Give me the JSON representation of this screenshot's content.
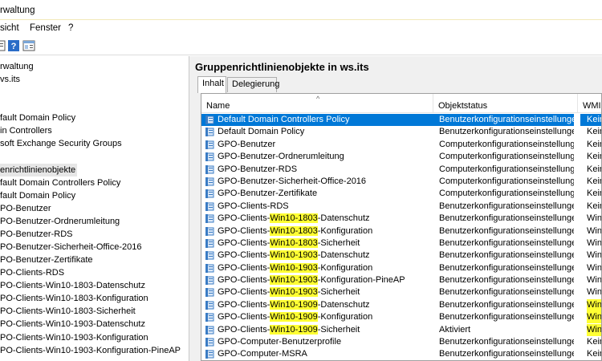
{
  "window": {
    "title": "rwaltung"
  },
  "menu": {
    "items": [
      "sicht",
      "Fenster",
      "?"
    ]
  },
  "tree": {
    "nodes": [
      {
        "label": "rwaltung",
        "selected": false
      },
      {
        "label": "vs.its",
        "selected": false
      },
      {
        "label": "",
        "selected": false
      },
      {
        "label": "fault Domain Policy",
        "selected": false
      },
      {
        "label": "in Controllers",
        "selected": false
      },
      {
        "label": "soft Exchange Security Groups",
        "selected": false
      },
      {
        "label": "",
        "selected": false
      },
      {
        "label": "enrichtlinienobjekte",
        "selected": true
      },
      {
        "label": "fault Domain Controllers Policy",
        "selected": false
      },
      {
        "label": "fault Domain Policy",
        "selected": false
      },
      {
        "label": "PO-Benutzer",
        "selected": false
      },
      {
        "label": "PO-Benutzer-Ordnerumleitung",
        "selected": false
      },
      {
        "label": "PO-Benutzer-RDS",
        "selected": false
      },
      {
        "label": "PO-Benutzer-Sicherheit-Office-2016",
        "selected": false
      },
      {
        "label": "PO-Benutzer-Zertifikate",
        "selected": false
      },
      {
        "label": "PO-Clients-RDS",
        "selected": false
      },
      {
        "label": "PO-Clients-Win10-1803-Datenschutz",
        "selected": false
      },
      {
        "label": "PO-Clients-Win10-1803-Konfiguration",
        "selected": false
      },
      {
        "label": "PO-Clients-Win10-1803-Sicherheit",
        "selected": false
      },
      {
        "label": "PO-Clients-Win10-1903-Datenschutz",
        "selected": false
      },
      {
        "label": "PO-Clients-Win10-1903-Konfiguration",
        "selected": false
      },
      {
        "label": "PO-Clients-Win10-1903-Konfiguration-PineAP",
        "selected": false
      }
    ]
  },
  "panel": {
    "heading": "Gruppenrichtlinienobjekte in ws.its",
    "tabs": [
      "Inhalt",
      "Delegierung"
    ],
    "columns": [
      "Name",
      "Objektstatus",
      "WMI"
    ],
    "rows": [
      {
        "pre": "Default Domain Controllers Policy",
        "hl": "",
        "post": "",
        "status": "Benutzerkonfigurationseinstellungen d...",
        "wmi": "Keine",
        "wmi_hl": false,
        "selected": true
      },
      {
        "pre": "Default Domain Policy",
        "hl": "",
        "post": "",
        "status": "Benutzerkonfigurationseinstellungen d...",
        "wmi": "Keine",
        "wmi_hl": false,
        "selected": false
      },
      {
        "pre": "GPO-Benutzer",
        "hl": "",
        "post": "",
        "status": "Computerkonfigurationseinstellungen d...",
        "wmi": "Keine",
        "wmi_hl": false,
        "selected": false
      },
      {
        "pre": "GPO-Benutzer-Ordnerumleitung",
        "hl": "",
        "post": "",
        "status": "Computerkonfigurationseinstellungen d...",
        "wmi": "Keine",
        "wmi_hl": false,
        "selected": false
      },
      {
        "pre": "GPO-Benutzer-RDS",
        "hl": "",
        "post": "",
        "status": "Computerkonfigurationseinstellungen d...",
        "wmi": "Keine",
        "wmi_hl": false,
        "selected": false
      },
      {
        "pre": "GPO-Benutzer-Sicherheit-Office-2016",
        "hl": "",
        "post": "",
        "status": "Computerkonfigurationseinstellungen d...",
        "wmi": "Keine",
        "wmi_hl": false,
        "selected": false
      },
      {
        "pre": "GPO-Benutzer-Zertifikate",
        "hl": "",
        "post": "",
        "status": "Computerkonfigurationseinstellungen d...",
        "wmi": "Keine",
        "wmi_hl": false,
        "selected": false
      },
      {
        "pre": "GPO-Clients-RDS",
        "hl": "",
        "post": "",
        "status": "Benutzerkonfigurationseinstellungen d...",
        "wmi": "Keine",
        "wmi_hl": false,
        "selected": false
      },
      {
        "pre": "GPO-Clients-",
        "hl": "Win10-1803",
        "post": "-Datenschutz",
        "status": "Benutzerkonfigurationseinstellungen d...",
        "wmi": "Wind",
        "wmi_hl": false,
        "selected": false
      },
      {
        "pre": "GPO-Clients-",
        "hl": "Win10-1803",
        "post": "-Konfiguration",
        "status": "Benutzerkonfigurationseinstellungen d...",
        "wmi": "Wind",
        "wmi_hl": false,
        "selected": false
      },
      {
        "pre": "GPO-Clients-",
        "hl": "Win10-1803",
        "post": "-Sicherheit",
        "status": "Benutzerkonfigurationseinstellungen d...",
        "wmi": "Wind",
        "wmi_hl": false,
        "selected": false
      },
      {
        "pre": "GPO-Clients-",
        "hl": "Win10-1903",
        "post": "-Datenschutz",
        "status": "Benutzerkonfigurationseinstellungen d...",
        "wmi": "Wind",
        "wmi_hl": false,
        "selected": false
      },
      {
        "pre": "GPO-Clients-",
        "hl": "Win10-1903",
        "post": "-Konfiguration",
        "status": "Benutzerkonfigurationseinstellungen d...",
        "wmi": "Wind",
        "wmi_hl": false,
        "selected": false
      },
      {
        "pre": "GPO-Clients-",
        "hl": "Win10-1903",
        "post": "-Konfiguration-PineAP",
        "status": "Benutzerkonfigurationseinstellungen d...",
        "wmi": "Wind",
        "wmi_hl": false,
        "selected": false
      },
      {
        "pre": "GPO-Clients-",
        "hl": "Win10-1903",
        "post": "-Sicherheit",
        "status": "Benutzerkonfigurationseinstellungen d...",
        "wmi": "Wind",
        "wmi_hl": false,
        "selected": false
      },
      {
        "pre": "GPO-Clients-",
        "hl": "Win10-1909",
        "post": "-Datenschutz",
        "status": "Benutzerkonfigurationseinstellungen d...",
        "wmi": "Wind",
        "wmi_hl": true,
        "selected": false
      },
      {
        "pre": "GPO-Clients-",
        "hl": "Win10-1909",
        "post": "-Konfiguration",
        "status": "Benutzerkonfigurationseinstellungen d...",
        "wmi": "Wind",
        "wmi_hl": true,
        "selected": false
      },
      {
        "pre": "GPO-Clients-",
        "hl": "Win10-1909",
        "post": "-Sicherheit",
        "status": "Aktiviert",
        "wmi": "Wind",
        "wmi_hl": true,
        "selected": false
      },
      {
        "pre": "GPO-Computer-Benutzerprofile",
        "hl": "",
        "post": "",
        "status": "Benutzerkonfigurationseinstellungen d...",
        "wmi": "Keine",
        "wmi_hl": false,
        "selected": false
      },
      {
        "pre": "GPO-Computer-MSRA",
        "hl": "",
        "post": "",
        "status": "Benutzerkonfigurationseinstellungen d...",
        "wmi": "Keine",
        "wmi_hl": false,
        "selected": false
      }
    ]
  },
  "colors": {
    "selection": "#0078d7",
    "highlight": "#ffff33",
    "gpo_icon": "#3b7cc4"
  }
}
